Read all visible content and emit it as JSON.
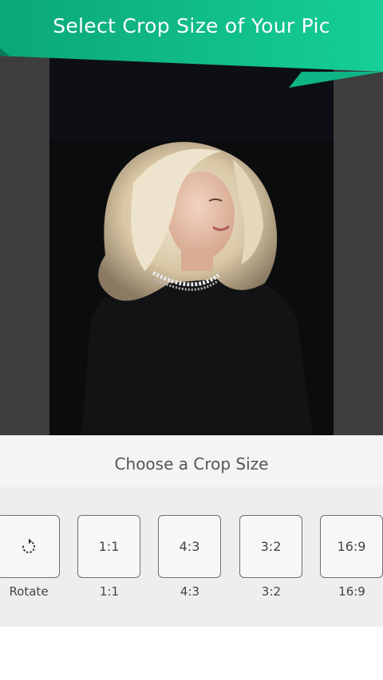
{
  "header": {
    "title": "Select Crop Size of Your Pic"
  },
  "colors": {
    "accent_green": "#11c48d",
    "accent_dark": "#0aa777",
    "background_gray": "#3d3d3d"
  },
  "photo": {
    "description_icon": "photo-preview"
  },
  "panel": {
    "title": "Choose a Crop Size",
    "options": [
      {
        "box": "",
        "icon": "rotate-icon",
        "label": "Rotate"
      },
      {
        "box": "1:1",
        "label": "1:1"
      },
      {
        "box": "4:3",
        "label": "4:3"
      },
      {
        "box": "3:2",
        "label": "3:2"
      },
      {
        "box": "16:9",
        "label": "16:9"
      }
    ]
  }
}
